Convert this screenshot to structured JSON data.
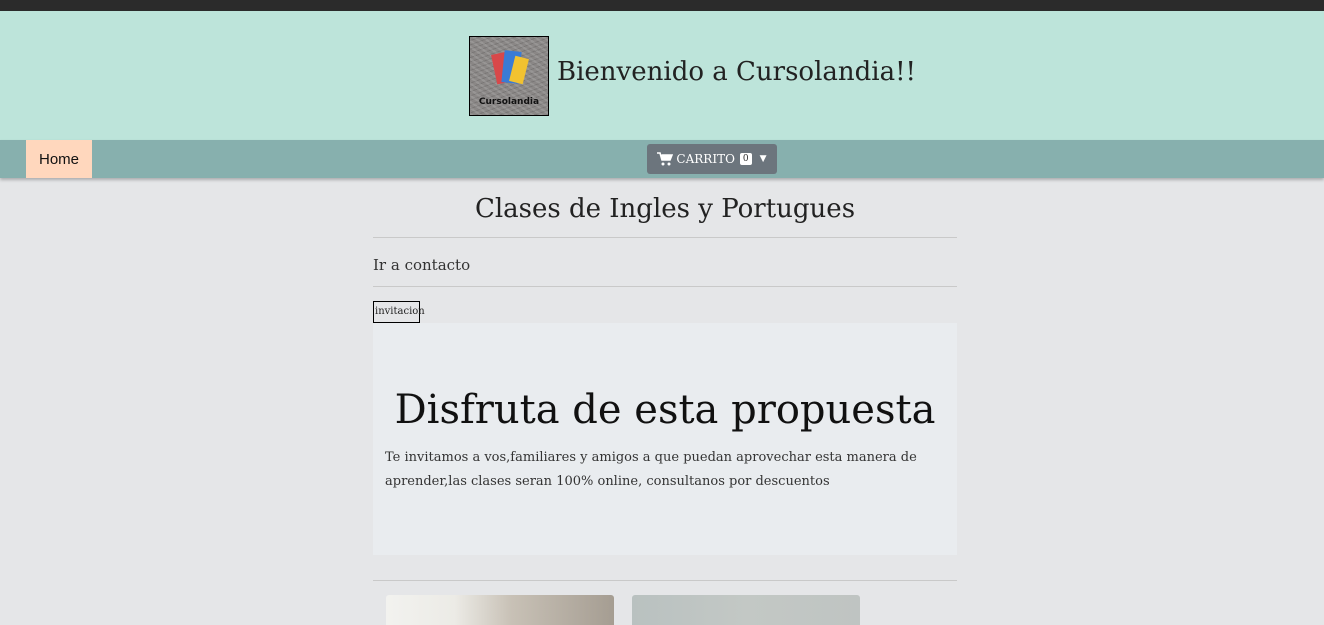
{
  "header": {
    "logo_text": "Cursolandia",
    "title": "Bienvenido a Cursolandia!!"
  },
  "nav": {
    "home": "Home",
    "cart_label": "CARRITO",
    "cart_count": "0"
  },
  "main": {
    "section_title": "Clases de Ingles y Portugues",
    "contact_link": "Ir a contacto",
    "image_alt": "invitacion",
    "jumbotron": {
      "title": "Disfruta de esta propuesta",
      "text": "Te invitamos a vos,familiares y amigos a que puedan aprovechar esta manera de aprender,las clases seran 100% online, consultanos por descuentos"
    }
  },
  "icons": {
    "cart": "cart-icon",
    "caret": "caret-down-icon"
  }
}
